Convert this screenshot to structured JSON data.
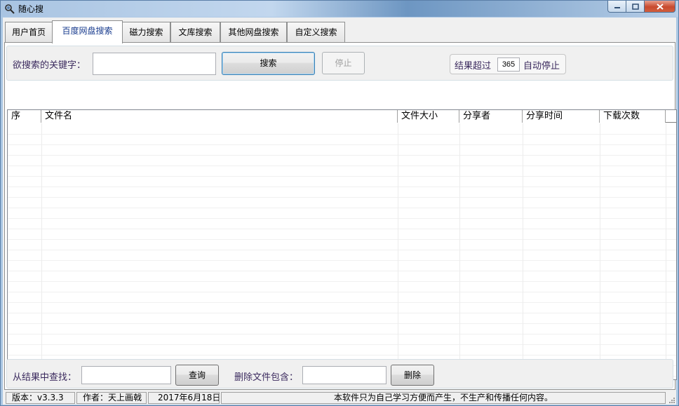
{
  "window": {
    "title": "随心搜"
  },
  "tabs": [
    {
      "label": "用户首页"
    },
    {
      "label": "百度网盘搜索"
    },
    {
      "label": "磁力搜索"
    },
    {
      "label": "文库搜索"
    },
    {
      "label": "其他网盘搜索"
    },
    {
      "label": "自定义搜索"
    }
  ],
  "search": {
    "keyword_label": "欲搜索的关键字：",
    "keyword_value": "",
    "search_button": "搜索",
    "stop_button": "停止",
    "limit_prefix": "结果超过",
    "limit_value": "365",
    "limit_suffix": "自动停止"
  },
  "results": {
    "columns": [
      "序",
      "文件名",
      "文件大小",
      "分享者",
      "分享时间",
      "下载次数"
    ],
    "rows": []
  },
  "filter": {
    "find_label": "从结果中查找：",
    "find_value": "",
    "query_button": "查询",
    "delete_label": "删除文件包含：",
    "delete_value": "",
    "delete_button": "删除"
  },
  "status": {
    "version": "版本：v3.3.3",
    "author": "作者：天上画戟",
    "date": "2017年6月18日",
    "notice": "本软件只为自己学习方便而产生，不生产和传播任何内容。"
  },
  "colors": {
    "active_tab_text": "#1a3d8f",
    "label_text": "#3b2a5e",
    "close_button": "#c84a2e"
  }
}
